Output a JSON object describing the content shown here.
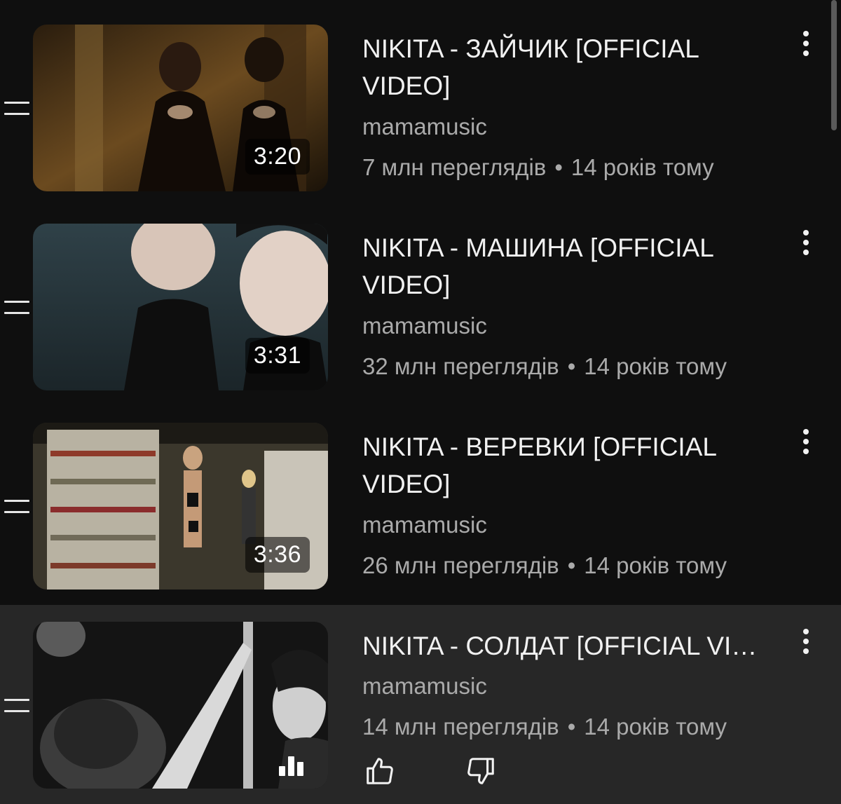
{
  "playlist": {
    "items": [
      {
        "title": "NIKITA - ЗАЙЧИК [OFFICIAL VIDEO]",
        "channel": "mamamusic",
        "views": "7 млн переглядів",
        "separator": "•",
        "age": "14 років тому",
        "duration": "3:20"
      },
      {
        "title": "NIKITA - МАШИНА [OFFICIAL VIDEO]",
        "channel": "mamamusic",
        "views": "32 млн переглядів",
        "separator": "•",
        "age": "14 років тому",
        "duration": "3:31"
      },
      {
        "title": "NIKITA - ВЕРЕВКИ [OFFICIAL VIDEO]",
        "channel": "mamamusic",
        "views": "26 млн переглядів",
        "separator": "•",
        "age": "14 років тому",
        "duration": "3:36"
      },
      {
        "title": "NIKITA - СОЛДАТ [OFFICIAL VIDEO]",
        "channel": "mamamusic",
        "views": "14 млн переглядів",
        "separator": "•",
        "age": "14 років тому",
        "now_playing": true
      }
    ]
  },
  "icons": {
    "drag_handle": "drag-handle-icon",
    "more": "more-vertical-icon",
    "like": "thumbs-up-icon",
    "dislike": "thumbs-down-icon",
    "now_playing": "equalizer-icon"
  },
  "colors": {
    "background": "#0f0f0f",
    "active_row": "#272727",
    "title_text": "#f1f1f1",
    "secondary_text": "#aaaaaa"
  }
}
